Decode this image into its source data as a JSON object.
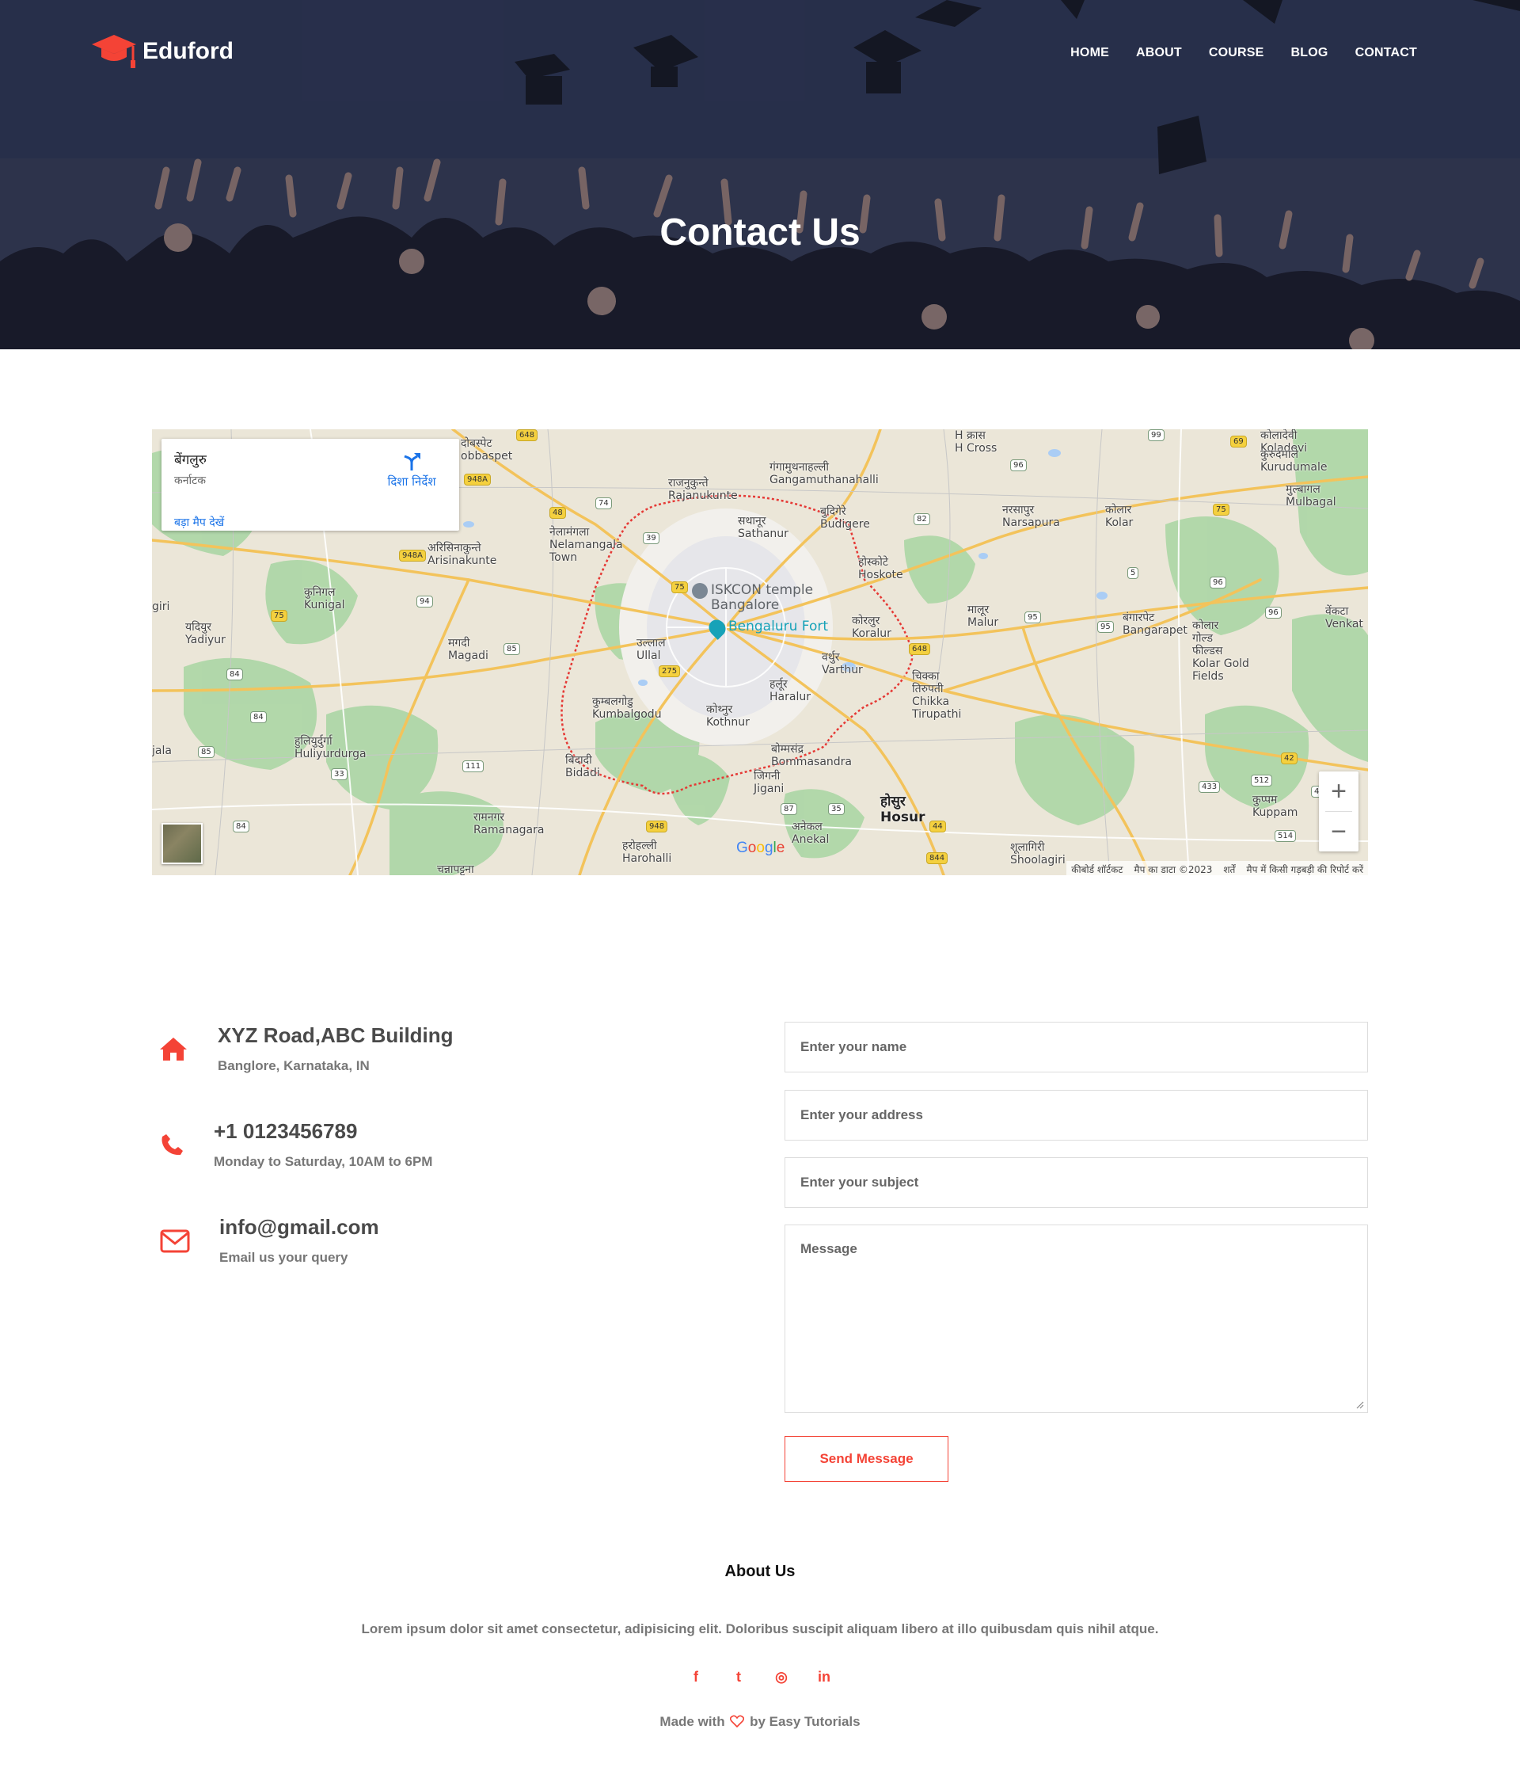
{
  "brand": {
    "name": "Eduford",
    "accent": "#f44336"
  },
  "nav": {
    "items": [
      "HOME",
      "ABOUT",
      "COURSE",
      "BLOG",
      "CONTACT"
    ]
  },
  "hero": {
    "title": "Contact Us"
  },
  "map": {
    "card": {
      "city": "बेंगलुरु",
      "state": "कर्नाटक",
      "larger_map": "बड़ा मैप देखें",
      "directions": "दिशा निर्देश"
    },
    "labels": [
      {
        "text": "दोबस्पेट\nobbaspet"
      },
      {
        "text": "राजनुकुन्ते\nRajanukunte"
      },
      {
        "text": "गंगामुथनाहल्ली\nGangamuthanahalli"
      },
      {
        "text": "H क्रास\nH Cross"
      },
      {
        "text": "कोलादेवी\nKoladevi"
      },
      {
        "text": "कुरुदमाले\nKurudumale"
      },
      {
        "text": "मुल्बागल\nMulbagal"
      },
      {
        "text": "बुदिगेरे\nBudigere"
      },
      {
        "text": "सथानूर\nSathanur"
      },
      {
        "text": "नरसापुर\nNarsapura"
      },
      {
        "text": "कोलार\nKolar"
      },
      {
        "text": "नेलामंगला\nNelamangala\nTown"
      },
      {
        "text": "अरिसिनाकुन्ते\nArisinakunte"
      },
      {
        "text": "होस्कोटे\nHoskote"
      },
      {
        "text": "कुनिगल\nKunigal"
      },
      {
        "text": "यदियुर\nYadiyur"
      },
      {
        "text": "मगदी\nMagadi"
      },
      {
        "text": "उल्लाल\nUllal"
      },
      {
        "text": "कोरलुर\nKoralur"
      },
      {
        "text": "मालूर\nMalur"
      },
      {
        "text": "बंगारपेट\nBangarapet"
      },
      {
        "text": "कोलार\nगोल्ड\nफील्डस\nKolar Gold\nFields"
      },
      {
        "text": "वेंकटा\nVenkat"
      },
      {
        "text": "वर्थुर\nVarthur"
      },
      {
        "text": "हर्लूर\nHaralur"
      },
      {
        "text": "चिक्का\nतिरुपती\nChikka\nTirupathi"
      },
      {
        "text": "कुम्बलगोडु\nKumbalgodu"
      },
      {
        "text": "कोथ्नुर\nKothnur"
      },
      {
        "text": "हुलियुर्दुर्गा\nHuliyurdurga"
      },
      {
        "text": "बिदादी\nBidadi"
      },
      {
        "text": "बोम्मसंद्र\nBommasandra"
      },
      {
        "text": "जिगनी\nJigani"
      },
      {
        "text": "कुप्पम\nKuppam"
      },
      {
        "text": "रामनगर\nRamanagara"
      },
      {
        "text": "अनेकल\nAnekal"
      },
      {
        "text": "हरोहल्ली\nHarohalli"
      },
      {
        "text": "शूलागिरी\nShoolagiri"
      },
      {
        "text": "चन्नापट्टना"
      },
      {
        "text": "jala"
      },
      {
        "text": "giri"
      }
    ],
    "hosur": "होसुर\nHosur",
    "pois": {
      "temple": "ISKCON temple\nBangalore",
      "fort": "Bengaluru Fort"
    },
    "shields": [
      "648",
      "948A",
      "74",
      "48",
      "39",
      "75",
      "94",
      "85",
      "84",
      "33",
      "111",
      "275",
      "948",
      "87",
      "35",
      "648",
      "44",
      "844",
      "96",
      "99",
      "69",
      "75",
      "82",
      "5",
      "95",
      "96",
      "95",
      "96",
      "42",
      "433",
      "512",
      "514",
      "43",
      "85",
      "84",
      "948A",
      "75",
      "84"
    ],
    "attribution": [
      "कीबोर्ड शॉर्टकट",
      "मैप का डाटा ©2023",
      "शर्तें",
      "मैप में किसी गड़बड़ी की रिपोर्ट करें"
    ],
    "google": "Google"
  },
  "contact": {
    "address": {
      "title": "XYZ Road,ABC Building",
      "sub": "Banglore, Karnataka, IN",
      "icon": "home-icon"
    },
    "phone": {
      "title": "+1 0123456789",
      "sub": "Monday to Saturday, 10AM to 6PM",
      "icon": "phone-icon"
    },
    "email": {
      "title": "info@gmail.com",
      "sub": "Email us your query",
      "icon": "envelope-icon"
    }
  },
  "form": {
    "name_placeholder": "Enter your name",
    "address_placeholder": "Enter your address",
    "subject_placeholder": "Enter your subject",
    "message_placeholder": "Message",
    "send_label": "Send Message"
  },
  "footer": {
    "title": "About Us",
    "text": "Lorem ipsum dolor sit amet consectetur, adipisicing elit. Doloribus suscipit aliquam libero at illo quibusdam quis nihil atque.",
    "social": [
      {
        "icon": "facebook-icon",
        "glyph": "f"
      },
      {
        "icon": "twitter-icon",
        "glyph": "t"
      },
      {
        "icon": "instagram-icon",
        "glyph": "◎"
      },
      {
        "icon": "linkedin-icon",
        "glyph": "in"
      }
    ],
    "made_before": "Made with",
    "made_after": "by Easy Tutorials"
  }
}
